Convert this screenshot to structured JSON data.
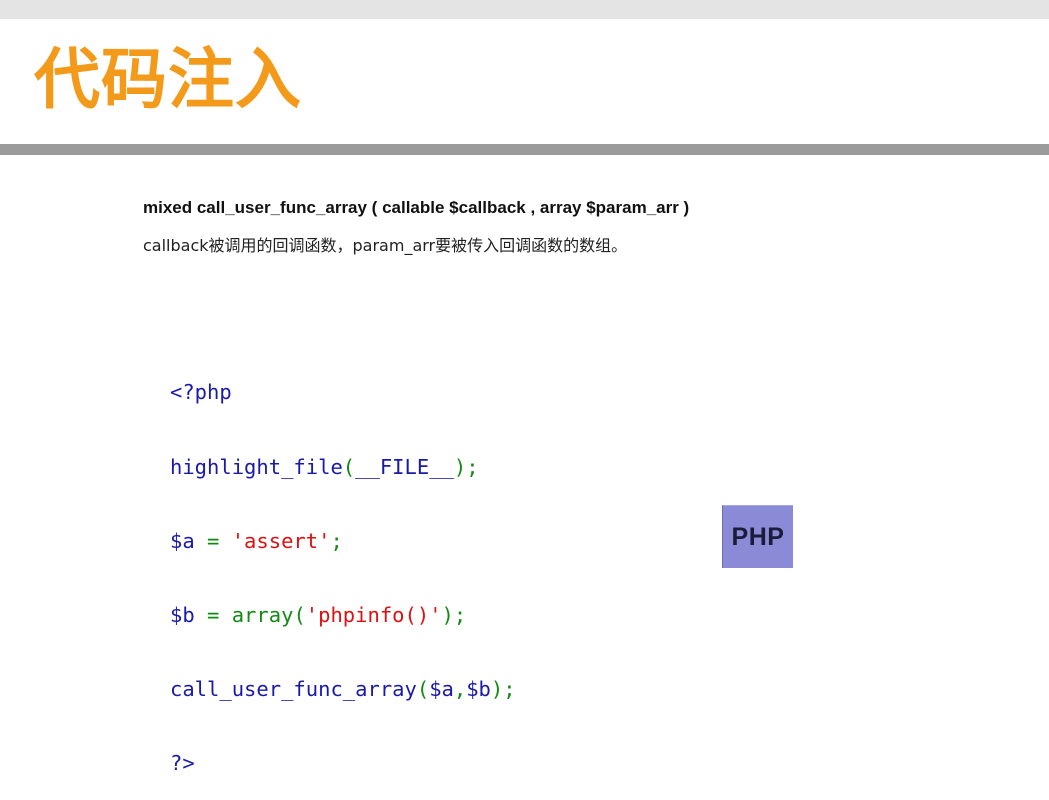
{
  "slide": {
    "title": "代码注入",
    "signature": "mixed call_user_func_array ( callable $callback , array $param_arr )",
    "description": "callback被调用的回调函数，param_arr要被传入回调函数的数组。"
  },
  "code": {
    "line1": {
      "open_tag": "<?php"
    },
    "line2": {
      "fn": "highlight_file",
      "open": "(",
      "const": "__FILE__",
      "close": ");"
    },
    "line3": {
      "var": "$a",
      "eq": " = ",
      "str": "'assert'",
      "end": ";"
    },
    "line4": {
      "var": "$b",
      "eq": " = ",
      "fn": "array",
      "open": "(",
      "str": "'phpinfo()'",
      "close": ");"
    },
    "line5": {
      "fn": "call_user_func_array",
      "open": "(",
      "arg1": "$a",
      "comma": ",",
      "arg2": "$b",
      "close": ");"
    },
    "line6": {
      "close_tag": "?>"
    }
  },
  "logo": {
    "text": "PHP"
  },
  "colors": {
    "title": "#f39a1b",
    "rule": "#9b9b9b",
    "code_keyword": "#1a1aaa",
    "code_operator": "#138a13",
    "code_string": "#dd1111",
    "logo_background": "#8a8ad6"
  }
}
